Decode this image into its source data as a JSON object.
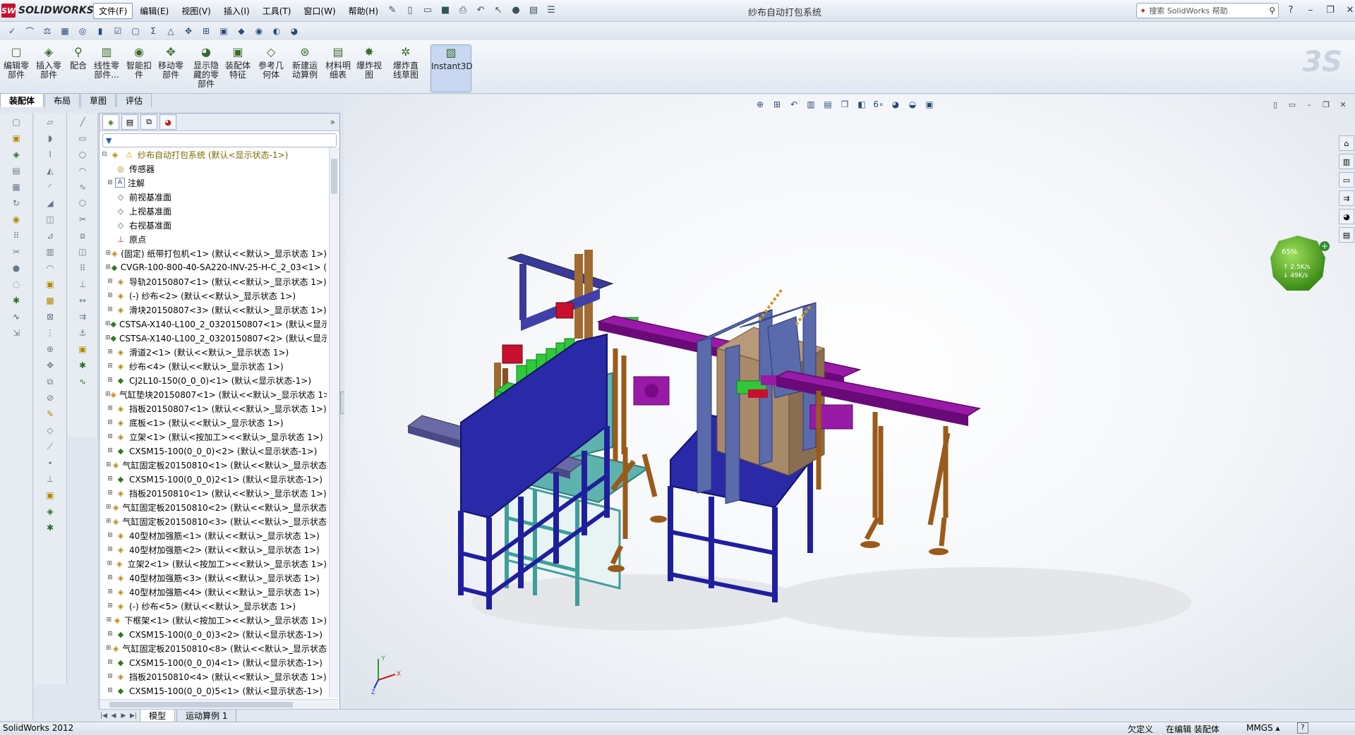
{
  "app": {
    "brand": "SOLIDWORKS",
    "brand_mark": "SW",
    "document_title": "纱布自动打包系统",
    "menu": [
      "文件(F)",
      "编辑(E)",
      "视图(V)",
      "插入(I)",
      "工具(T)",
      "窗口(W)",
      "帮助(H)"
    ],
    "active_menu": 0,
    "search_placeholder": "搜索 SolidWorks 帮助"
  },
  "command_manager": {
    "buttons": [
      {
        "label": "编辑零\n部件",
        "icon": "edit-component-icon"
      },
      {
        "label": "插入零\n部件",
        "icon": "insert-component-icon"
      },
      {
        "label": "配合",
        "icon": "mate-icon"
      },
      {
        "label": "线性零\n部件...",
        "icon": "linear-pattern-icon"
      },
      {
        "label": "智能扣\n件",
        "icon": "smart-fastener-icon"
      },
      {
        "label": "移动零\n部件",
        "icon": "move-component-icon"
      },
      {
        "label": "显示隐\n藏的零\n部件",
        "icon": "show-hidden-icon"
      },
      {
        "label": "装配体\n特征",
        "icon": "assembly-feature-icon"
      },
      {
        "label": "参考几\n何体",
        "icon": "reference-geometry-icon"
      },
      {
        "label": "新建运\n动算例",
        "icon": "motion-study-icon"
      },
      {
        "label": "材料明\n细表",
        "icon": "bom-icon"
      },
      {
        "label": "爆炸视\n图",
        "icon": "exploded-view-icon"
      },
      {
        "label": "爆炸直\n线草图",
        "icon": "explode-line-sketch-icon"
      },
      {
        "label": "Instant3D",
        "icon": "instant3d-icon"
      }
    ],
    "tabs": [
      "装配体",
      "布局",
      "草图",
      "评估"
    ],
    "active_tab": 0
  },
  "feature_tree": {
    "root": "纱布自动打包系统 (默认<显示状态-1>)",
    "nodes": [
      {
        "label": "传感器",
        "icon": "sensor"
      },
      {
        "label": "注解",
        "icon": "note",
        "exp": true
      },
      {
        "label": "前视基准面",
        "icon": "plane"
      },
      {
        "label": "上视基准面",
        "icon": "plane"
      },
      {
        "label": "右视基准面",
        "icon": "plane"
      },
      {
        "label": "原点",
        "icon": "origin"
      },
      {
        "label": "(固定) 纸带打包机<1> (默认<<默认>_显示状态 1>)",
        "icon": "asm",
        "exp": true
      },
      {
        "label": "CVGR-100-800-40-SA220-INV-25-H-C_2_03<1> (",
        "icon": "part",
        "exp": true
      },
      {
        "label": "导轨20150807<1> (默认<<默认>_显示状态 1>)",
        "icon": "asm",
        "exp": true
      },
      {
        "label": "(-) 纱布<2> (默认<<默认>_显示状态 1>)",
        "icon": "asm",
        "exp": true
      },
      {
        "label": "滑块20150807<3> (默认<<默认>_显示状态 1>)",
        "icon": "asm",
        "exp": true
      },
      {
        "label": "CSTSA-X140-L100_2_0320150807<1> (默认<显示",
        "icon": "part",
        "exp": true
      },
      {
        "label": "CSTSA-X140-L100_2_0320150807<2> (默认<显示",
        "icon": "part",
        "exp": true
      },
      {
        "label": "滑道2<1> (默认<<默认>_显示状态 1>)",
        "icon": "asm",
        "exp": true
      },
      {
        "label": "纱布<4> (默认<<默认>_显示状态 1>)",
        "icon": "asm",
        "exp": true
      },
      {
        "label": "CJ2L10-150(0_0_0)<1> (默认<显示状态-1>)",
        "icon": "part",
        "exp": true
      },
      {
        "label": "气缸垫块20150807<1> (默认<<默认>_显示状态 1>",
        "icon": "asm",
        "exp": true
      },
      {
        "label": "挡板20150807<1> (默认<<默认>_显示状态 1>)",
        "icon": "asm",
        "exp": true
      },
      {
        "label": "底板<1> (默认<<默认>_显示状态 1>)",
        "icon": "asm",
        "exp": true
      },
      {
        "label": "立架<1> (默认<按加工><<默认>_显示状态 1>)",
        "icon": "asm",
        "exp": true
      },
      {
        "label": "CXSM15-100(0_0_0)<2> (默认<显示状态-1>)",
        "icon": "part",
        "exp": true
      },
      {
        "label": "气缸固定板20150810<1> (默认<<默认>_显示状态",
        "icon": "asm",
        "exp": true
      },
      {
        "label": "CXSM15-100(0_0_0)2<1> (默认<显示状态-1>)",
        "icon": "part",
        "exp": true
      },
      {
        "label": "挡板20150810<1> (默认<<默认>_显示状态 1>)",
        "icon": "asm",
        "exp": true
      },
      {
        "label": "气缸固定板20150810<2> (默认<<默认>_显示状态",
        "icon": "asm",
        "exp": true
      },
      {
        "label": "气缸固定板20150810<3> (默认<<默认>_显示状态",
        "icon": "asm",
        "exp": true
      },
      {
        "label": "40型材加强筋<1> (默认<<默认>_显示状态 1>)",
        "icon": "asm",
        "exp": true
      },
      {
        "label": "40型材加强筋<2> (默认<<默认>_显示状态 1>)",
        "icon": "asm",
        "exp": true
      },
      {
        "label": "立架2<1> (默认<按加工><<默认>_显示状态 1>)",
        "icon": "asm",
        "exp": true
      },
      {
        "label": "40型材加强筋<3> (默认<<默认>_显示状态 1>)",
        "icon": "asm",
        "exp": true
      },
      {
        "label": "40型材加强筋<4> (默认<<默认>_显示状态 1>)",
        "icon": "asm",
        "exp": true
      },
      {
        "label": "(-) 纱布<5> (默认<<默认>_显示状态 1>)",
        "icon": "asm",
        "exp": true
      },
      {
        "label": "下框架<1> (默认<按加工><<默认>_显示状态 1>)",
        "icon": "asm",
        "exp": true
      },
      {
        "label": "CXSM15-100(0_0_0)3<2> (默认<显示状态-1>)",
        "icon": "part",
        "exp": true
      },
      {
        "label": "气缸固定板20150810<8> (默认<<默认>_显示状态",
        "icon": "asm",
        "exp": true
      },
      {
        "label": "CXSM15-100(0_0_0)4<1> (默认<显示状态-1>)",
        "icon": "part",
        "exp": true
      },
      {
        "label": "挡板20150810<4> (默认<<默认>_显示状态 1>)",
        "icon": "asm",
        "exp": true
      },
      {
        "label": "CXSM15-100(0_0_0)5<1> (默认<显示状态-1>)",
        "icon": "part",
        "exp": true
      }
    ]
  },
  "bottom_tabs": [
    "模型",
    "运动算例 1"
  ],
  "active_bottom_tab": 0,
  "status": {
    "app_version": "SolidWorks 2012",
    "definition": "欠定义",
    "editing": "在编辑 装配体",
    "units": "MMGS",
    "help": "?"
  },
  "net_meter": {
    "percent": "65%",
    "up": "2.5K/s",
    "down": "49K/s"
  },
  "triad": {
    "x": "X",
    "y": "Y",
    "z": "Z"
  },
  "colors": {
    "frame_blue": "#1f1f9e",
    "frame_teal": "#3f9e9a",
    "conveyor_purple": "#9a1aa8",
    "cabinet_brown": "#a88a6a",
    "rail_brown": "#9a5a1a",
    "package_green": "#2fc83a",
    "accent_red": "#c8102e"
  }
}
